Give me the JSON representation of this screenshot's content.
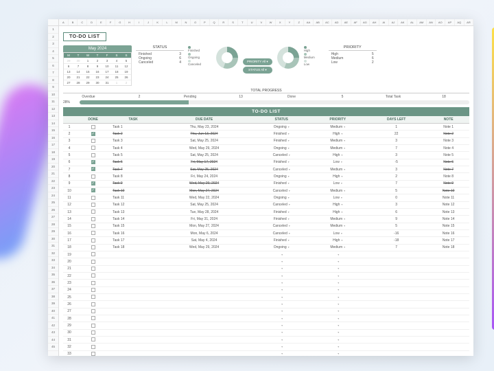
{
  "title": "TO-DO LIST",
  "calendar": {
    "month": "May 2024",
    "dow": [
      "M",
      "T",
      "W",
      "T",
      "F",
      "S",
      "S"
    ]
  },
  "status": {
    "title": "STATUS",
    "rows": [
      [
        "Finished",
        "3"
      ],
      [
        "Ongoing",
        "6"
      ],
      [
        "Canceled",
        "4"
      ]
    ]
  },
  "status_legend": [
    "Finished",
    "Ongoing",
    "Canceled"
  ],
  "priority_legend": [
    "High",
    "Medium",
    "Low"
  ],
  "priority": {
    "title": "PRIORITY",
    "rows": [
      [
        "High",
        "5"
      ],
      [
        "Medium",
        "6"
      ],
      [
        "Low",
        "2"
      ]
    ]
  },
  "filters": {
    "priority": "PRIORITY  All ▾",
    "status": "STATUS  All ▾"
  },
  "progress": {
    "title": "TOTAL PROGRESS",
    "overdue_l": "Overdue",
    "overdue_v": "2",
    "pending_l": "Pending",
    "pending_v": "13",
    "done_l": "Done",
    "done_v": "5",
    "total_l": "Total Task",
    "total_v": "18",
    "pct": "28%"
  },
  "table_title": "TO-DO LIST",
  "cols": [
    "DONE",
    "TASK",
    "DUE DATE",
    "STATUS",
    "PRIORITY",
    "DAYS LEFT",
    "NOTE"
  ],
  "rows": [
    {
      "n": "1",
      "d": 0,
      "t": "Task 1",
      "dd": "Thu, May 23, 2024",
      "s": "Ongoing",
      "p": "Medium",
      "dl": "1",
      "nt": "Note 1"
    },
    {
      "n": "2",
      "d": 1,
      "t": "Task 2",
      "dd": "Thu, Jun 13, 2024",
      "s": "Finished",
      "p": "High",
      "dl": "22",
      "nt": "Note 2",
      "st": 1
    },
    {
      "n": "3",
      "d": 0,
      "t": "Task 3",
      "dd": "Sat, May 25, 2024",
      "s": "Finished",
      "p": "Medium",
      "dl": "3",
      "nt": "Note 3"
    },
    {
      "n": "4",
      "d": 0,
      "t": "Task 4",
      "dd": "Wed, May 29, 2024",
      "s": "Ongoing",
      "p": "Medium",
      "dl": "7",
      "nt": "Note 4"
    },
    {
      "n": "5",
      "d": 0,
      "t": "Task 5",
      "dd": "Sat, May 25, 2024",
      "s": "Canceled",
      "p": "High",
      "dl": "3",
      "nt": "Note 5"
    },
    {
      "n": "6",
      "d": 1,
      "t": "Task 6",
      "dd": "Fri, May 17, 2024",
      "s": "Finished",
      "p": "Low",
      "dl": "-5",
      "nt": "Note 6",
      "st": 1
    },
    {
      "n": "7",
      "d": 1,
      "t": "Task 7",
      "dd": "Sat, May 25, 2024",
      "s": "Canceled",
      "p": "Medium",
      "dl": "3",
      "nt": "Note 7",
      "st": 1
    },
    {
      "n": "8",
      "d": 0,
      "t": "Task 8",
      "dd": "Fri, May 24, 2024",
      "s": "Ongoing",
      "p": "High",
      "dl": "2",
      "nt": "Note 8"
    },
    {
      "n": "9",
      "d": 1,
      "t": "Task 9",
      "dd": "Wed, May 29, 2024",
      "s": "Finished",
      "p": "Low",
      "dl": "7",
      "nt": "Note 9",
      "st": 1
    },
    {
      "n": "10",
      "d": 1,
      "t": "Task 10",
      "dd": "Mon, May 27, 2024",
      "s": "Canceled",
      "p": "Medium",
      "dl": "5",
      "nt": "Note 10",
      "st": 1
    },
    {
      "n": "11",
      "d": 0,
      "t": "Task 11",
      "dd": "Wed, May 22, 2024",
      "s": "Ongoing",
      "p": "Low",
      "dl": "0",
      "nt": "Note 11"
    },
    {
      "n": "12",
      "d": 0,
      "t": "Task 12",
      "dd": "Sat, May 25, 2024",
      "s": "Canceled",
      "p": "High",
      "dl": "3",
      "nt": "Note 12"
    },
    {
      "n": "13",
      "d": 0,
      "t": "Task 13",
      "dd": "Tue, May 28, 2024",
      "s": "Finished",
      "p": "High",
      "dl": "6",
      "nt": "Note 13"
    },
    {
      "n": "14",
      "d": 0,
      "t": "Task 14",
      "dd": "Fri, May 31, 2024",
      "s": "Finished",
      "p": "Medium",
      "dl": "9",
      "nt": "Note 14"
    },
    {
      "n": "15",
      "d": 0,
      "t": "Task 15",
      "dd": "Mon, May 27, 2024",
      "s": "Canceled",
      "p": "Medium",
      "dl": "5",
      "nt": "Note 15"
    },
    {
      "n": "16",
      "d": 0,
      "t": "Task 16",
      "dd": "Mon, May 6, 2024",
      "s": "Canceled",
      "p": "Low",
      "dl": "-16",
      "nt": "Note 16"
    },
    {
      "n": "17",
      "d": 0,
      "t": "Task 17",
      "dd": "Sat, May 4, 2024",
      "s": "Finished",
      "p": "High",
      "dl": "-18",
      "nt": "Note 17"
    },
    {
      "n": "18",
      "d": 0,
      "t": "Task 18",
      "dd": "Wed, May 29, 2024",
      "s": "Ongoing",
      "p": "Medium",
      "dl": "7",
      "nt": "Note 18"
    }
  ],
  "col_letters": [
    "A",
    "B",
    "C",
    "D",
    "E",
    "F",
    "G",
    "H",
    "I",
    "J",
    "K",
    "L",
    "M",
    "N",
    "O",
    "P",
    "Q",
    "R",
    "S",
    "T",
    "U",
    "V",
    "W",
    "X",
    "Y",
    "Z",
    "AA",
    "AB",
    "AC",
    "AD",
    "AE",
    "AF",
    "AG",
    "AH",
    "AI",
    "AJ",
    "AK",
    "AL",
    "AM",
    "AN",
    "AO",
    "AP",
    "AQ",
    "AR"
  ]
}
